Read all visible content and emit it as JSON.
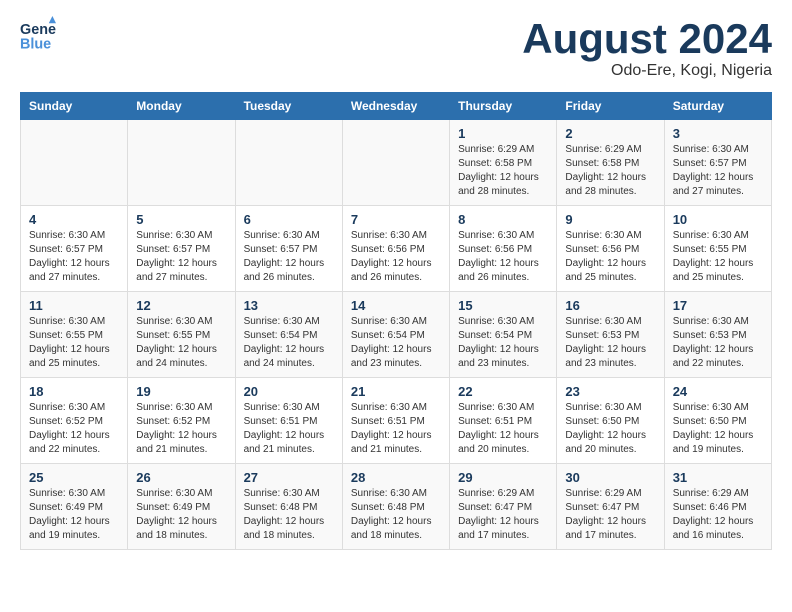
{
  "logo": {
    "general": "General",
    "blue": "Blue"
  },
  "title": "August 2024",
  "subtitle": "Odo-Ere, Kogi, Nigeria",
  "days_of_week": [
    "Sunday",
    "Monday",
    "Tuesday",
    "Wednesday",
    "Thursday",
    "Friday",
    "Saturday"
  ],
  "weeks": [
    [
      {
        "day": "",
        "info": ""
      },
      {
        "day": "",
        "info": ""
      },
      {
        "day": "",
        "info": ""
      },
      {
        "day": "",
        "info": ""
      },
      {
        "day": "1",
        "info": "Sunrise: 6:29 AM\nSunset: 6:58 PM\nDaylight: 12 hours and 28 minutes."
      },
      {
        "day": "2",
        "info": "Sunrise: 6:29 AM\nSunset: 6:58 PM\nDaylight: 12 hours and 28 minutes."
      },
      {
        "day": "3",
        "info": "Sunrise: 6:30 AM\nSunset: 6:57 PM\nDaylight: 12 hours and 27 minutes."
      }
    ],
    [
      {
        "day": "4",
        "info": "Sunrise: 6:30 AM\nSunset: 6:57 PM\nDaylight: 12 hours and 27 minutes."
      },
      {
        "day": "5",
        "info": "Sunrise: 6:30 AM\nSunset: 6:57 PM\nDaylight: 12 hours and 27 minutes."
      },
      {
        "day": "6",
        "info": "Sunrise: 6:30 AM\nSunset: 6:57 PM\nDaylight: 12 hours and 26 minutes."
      },
      {
        "day": "7",
        "info": "Sunrise: 6:30 AM\nSunset: 6:56 PM\nDaylight: 12 hours and 26 minutes."
      },
      {
        "day": "8",
        "info": "Sunrise: 6:30 AM\nSunset: 6:56 PM\nDaylight: 12 hours and 26 minutes."
      },
      {
        "day": "9",
        "info": "Sunrise: 6:30 AM\nSunset: 6:56 PM\nDaylight: 12 hours and 25 minutes."
      },
      {
        "day": "10",
        "info": "Sunrise: 6:30 AM\nSunset: 6:55 PM\nDaylight: 12 hours and 25 minutes."
      }
    ],
    [
      {
        "day": "11",
        "info": "Sunrise: 6:30 AM\nSunset: 6:55 PM\nDaylight: 12 hours and 25 minutes."
      },
      {
        "day": "12",
        "info": "Sunrise: 6:30 AM\nSunset: 6:55 PM\nDaylight: 12 hours and 24 minutes."
      },
      {
        "day": "13",
        "info": "Sunrise: 6:30 AM\nSunset: 6:54 PM\nDaylight: 12 hours and 24 minutes."
      },
      {
        "day": "14",
        "info": "Sunrise: 6:30 AM\nSunset: 6:54 PM\nDaylight: 12 hours and 23 minutes."
      },
      {
        "day": "15",
        "info": "Sunrise: 6:30 AM\nSunset: 6:54 PM\nDaylight: 12 hours and 23 minutes."
      },
      {
        "day": "16",
        "info": "Sunrise: 6:30 AM\nSunset: 6:53 PM\nDaylight: 12 hours and 23 minutes."
      },
      {
        "day": "17",
        "info": "Sunrise: 6:30 AM\nSunset: 6:53 PM\nDaylight: 12 hours and 22 minutes."
      }
    ],
    [
      {
        "day": "18",
        "info": "Sunrise: 6:30 AM\nSunset: 6:52 PM\nDaylight: 12 hours and 22 minutes."
      },
      {
        "day": "19",
        "info": "Sunrise: 6:30 AM\nSunset: 6:52 PM\nDaylight: 12 hours and 21 minutes."
      },
      {
        "day": "20",
        "info": "Sunrise: 6:30 AM\nSunset: 6:51 PM\nDaylight: 12 hours and 21 minutes."
      },
      {
        "day": "21",
        "info": "Sunrise: 6:30 AM\nSunset: 6:51 PM\nDaylight: 12 hours and 21 minutes."
      },
      {
        "day": "22",
        "info": "Sunrise: 6:30 AM\nSunset: 6:51 PM\nDaylight: 12 hours and 20 minutes."
      },
      {
        "day": "23",
        "info": "Sunrise: 6:30 AM\nSunset: 6:50 PM\nDaylight: 12 hours and 20 minutes."
      },
      {
        "day": "24",
        "info": "Sunrise: 6:30 AM\nSunset: 6:50 PM\nDaylight: 12 hours and 19 minutes."
      }
    ],
    [
      {
        "day": "25",
        "info": "Sunrise: 6:30 AM\nSunset: 6:49 PM\nDaylight: 12 hours and 19 minutes."
      },
      {
        "day": "26",
        "info": "Sunrise: 6:30 AM\nSunset: 6:49 PM\nDaylight: 12 hours and 18 minutes."
      },
      {
        "day": "27",
        "info": "Sunrise: 6:30 AM\nSunset: 6:48 PM\nDaylight: 12 hours and 18 minutes."
      },
      {
        "day": "28",
        "info": "Sunrise: 6:30 AM\nSunset: 6:48 PM\nDaylight: 12 hours and 18 minutes."
      },
      {
        "day": "29",
        "info": "Sunrise: 6:29 AM\nSunset: 6:47 PM\nDaylight: 12 hours and 17 minutes."
      },
      {
        "day": "30",
        "info": "Sunrise: 6:29 AM\nSunset: 6:47 PM\nDaylight: 12 hours and 17 minutes."
      },
      {
        "day": "31",
        "info": "Sunrise: 6:29 AM\nSunset: 6:46 PM\nDaylight: 12 hours and 16 minutes."
      }
    ]
  ]
}
